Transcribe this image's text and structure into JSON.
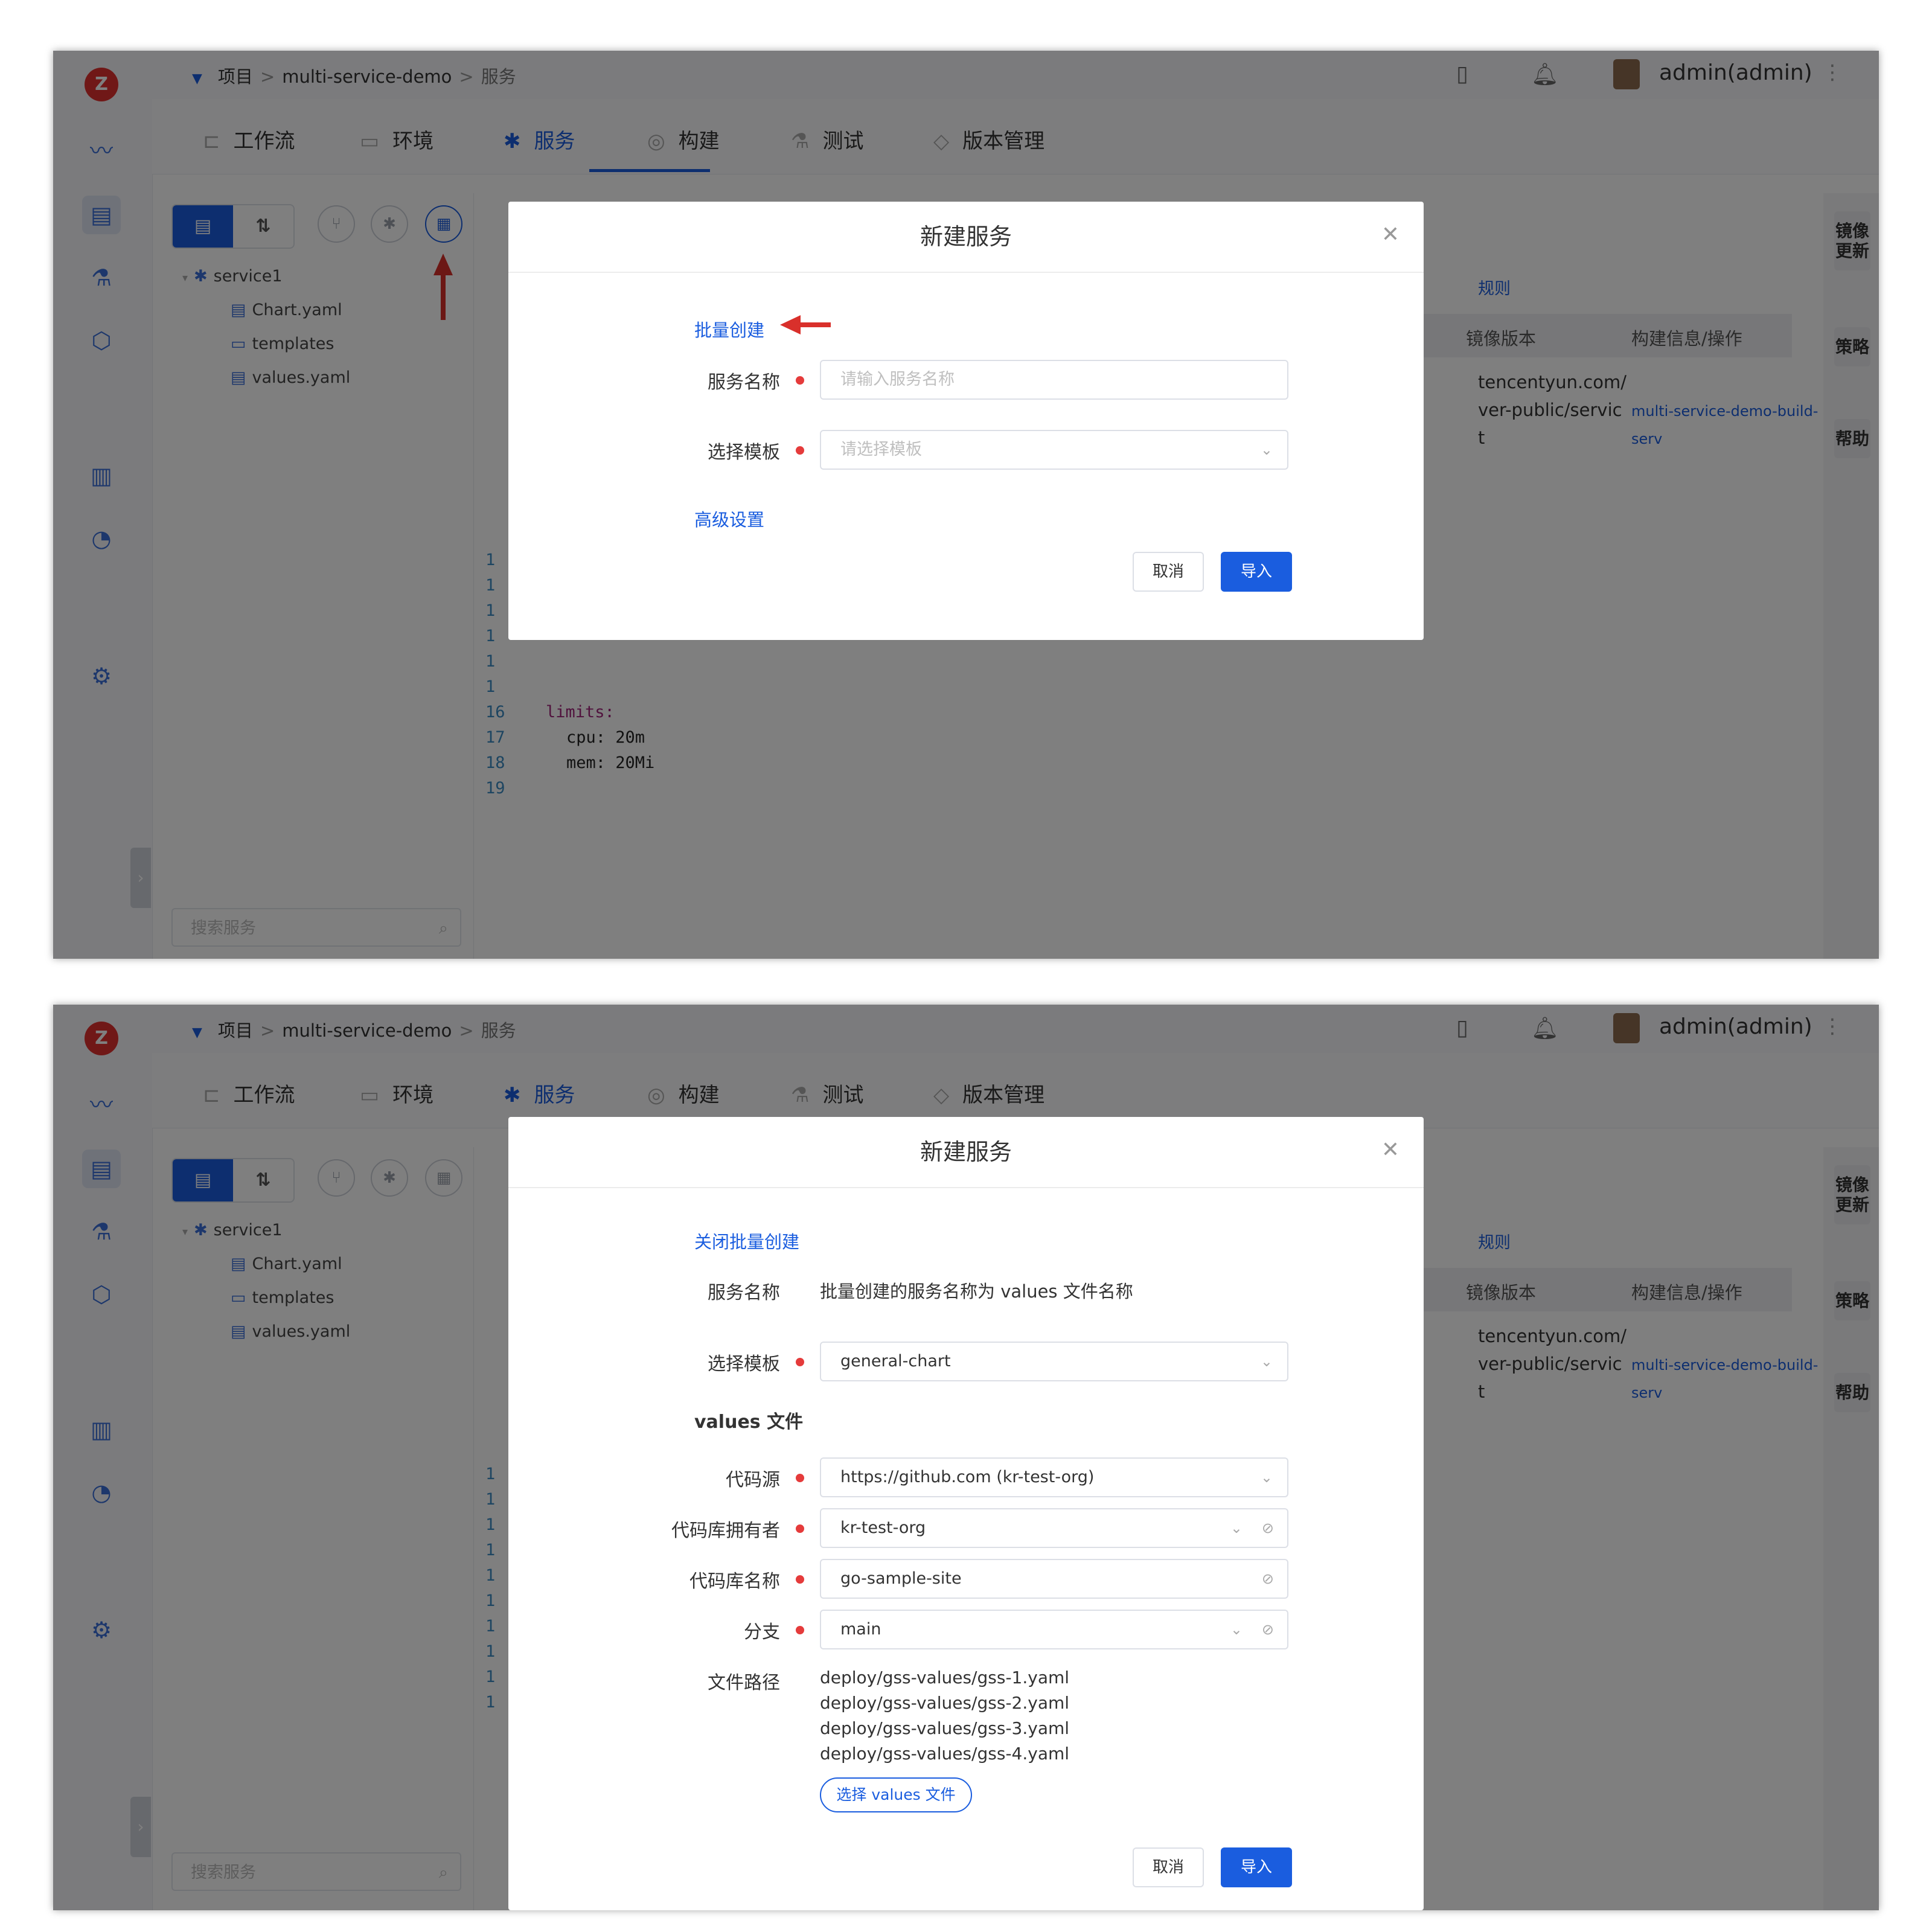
{
  "app": {
    "breadcrumb": {
      "root": "项目",
      "sep": ">",
      "project": "multi-service-demo",
      "current": "服务"
    },
    "user": "admin(admin)",
    "tabs": [
      "工作流",
      "环境",
      "服务",
      "构建",
      "测试",
      "版本管理"
    ],
    "active_tab": "服务",
    "tree": {
      "service": "service1",
      "files": [
        "Chart.yaml",
        "templates",
        "values.yaml"
      ]
    },
    "search_placeholder": "搜索服务",
    "editor_lines": [
      "16",
      "17",
      "18",
      "19"
    ],
    "editor_code": [
      "limits:",
      "cpu: 20m",
      "mem: 20Mi",
      ""
    ],
    "gutter_digit": "1",
    "right_panel": {
      "link_fragment": "规则",
      "col_image": "镜像版本",
      "col_build": "构建信息/操作",
      "image_lines": [
        "tencentyun.com/",
        "ver-public/servic",
        "t"
      ],
      "build_link": "multi-service-demo-build-serv"
    },
    "right_tabs": [
      "镜像更新",
      "策略",
      "帮助"
    ],
    "colors": {
      "accent": "#1a5ddf",
      "required": "#e53b3b",
      "arrow": "#d9302b",
      "logo": "#e0302f"
    }
  },
  "dialog1": {
    "title": "新建服务",
    "batch_link": "批量创建",
    "service_name_label": "服务名称",
    "service_name_placeholder": "请输入服务名称",
    "template_label": "选择模板",
    "template_placeholder": "请选择模板",
    "advanced_link": "高级设置",
    "cancel": "取消",
    "import": "导入"
  },
  "dialog2": {
    "title": "新建服务",
    "close_batch_link": "关闭批量创建",
    "service_name_label": "服务名称",
    "service_name_note": "批量创建的服务名称为 values 文件名称",
    "template_label": "选择模板",
    "template_value": "general-chart",
    "values_section": "values 文件",
    "source_label": "代码源",
    "source_value": "https://github.com (kr-test-org)",
    "owner_label": "代码库拥有者",
    "owner_value": "kr-test-org",
    "repo_label": "代码库名称",
    "repo_value": "go-sample-site",
    "branch_label": "分支",
    "branch_value": "main",
    "path_label": "文件路径",
    "paths": [
      "deploy/gss-values/gss-1.yaml",
      "deploy/gss-values/gss-2.yaml",
      "deploy/gss-values/gss-3.yaml",
      "deploy/gss-values/gss-4.yaml"
    ],
    "select_values_button": "选择 values 文件",
    "cancel": "取消",
    "import": "导入"
  }
}
